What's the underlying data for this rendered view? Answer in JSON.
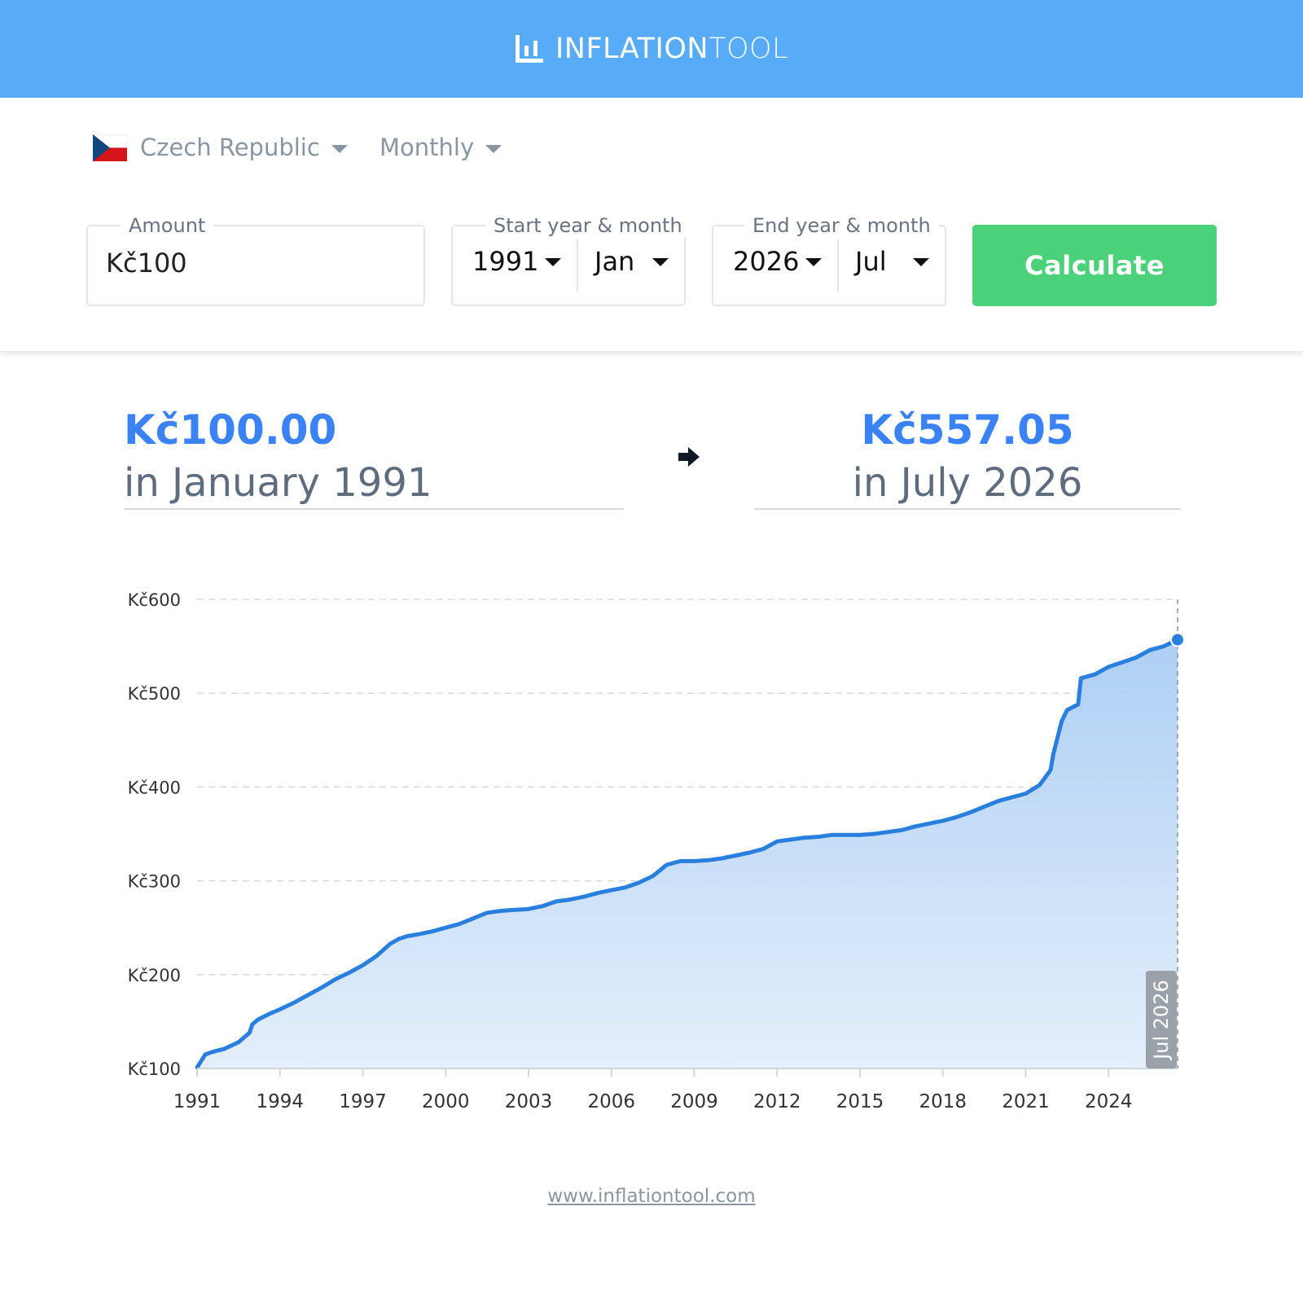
{
  "header": {
    "logo_bold": "INFLATION",
    "logo_light": "TOOL",
    "logo_icon": "bar-chart-icon"
  },
  "controls": {
    "country": "Czech Republic",
    "frequency": "Monthly",
    "amount_label": "Amount",
    "amount_value": "Kč100",
    "start_label": "Start year & month",
    "start_year": "1991",
    "start_month": "Jan",
    "end_label": "End year & month",
    "end_year": "2026",
    "end_month": "Jul",
    "calculate_label": "Calculate"
  },
  "result": {
    "start_amount": "Kč100.00",
    "start_when": "in January 1991",
    "end_amount": "Kč557.05",
    "end_when": "in July 2026"
  },
  "colors": {
    "header": "#58acf7",
    "accent": "#3b82f6",
    "line": "#2a7fdc",
    "button": "#4bd17a"
  },
  "chart_data": {
    "type": "area",
    "x_ticks": [
      "1991",
      "1994",
      "1997",
      "2000",
      "2003",
      "2006",
      "2009",
      "2012",
      "2015",
      "2018",
      "2021",
      "2024"
    ],
    "y_ticks": [
      "Kč100",
      "Kč200",
      "Kč300",
      "Kč400",
      "Kč500",
      "Kč600"
    ],
    "ylim": [
      100,
      600
    ],
    "xlim": [
      1991.0,
      2026.5
    ],
    "grid": true,
    "marker_label": "Jul 2026",
    "series": [
      {
        "x": [
          1991.0,
          1991.3,
          1991.6,
          1992.0,
          1992.5,
          1992.9,
          1993.0,
          1993.2,
          1993.6,
          1994.0,
          1994.5,
          1995.0,
          1995.5,
          1996.0,
          1996.5,
          1997.0,
          1997.5,
          1998.0,
          1998.3,
          1998.6,
          1999.0,
          1999.5,
          2000.0,
          2000.5,
          2001.0,
          2001.5,
          2002.0,
          2002.5,
          2003.0,
          2003.5,
          2004.0,
          2004.5,
          2005.0,
          2005.5,
          2006.0,
          2006.5,
          2007.0,
          2007.5,
          2008.0,
          2008.5,
          2009.0,
          2009.5,
          2010.0,
          2010.5,
          2011.0,
          2011.5,
          2012.0,
          2012.5,
          2013.0,
          2013.5,
          2014.0,
          2014.5,
          2015.0,
          2015.5,
          2016.0,
          2016.5,
          2017.0,
          2017.5,
          2018.0,
          2018.5,
          2019.0,
          2019.5,
          2020.0,
          2020.5,
          2021.0,
          2021.5,
          2021.9,
          2022.0,
          2022.3,
          2022.5,
          2022.9,
          2023.0,
          2023.5,
          2024.0,
          2024.5,
          2025.0,
          2025.5,
          2026.0,
          2026.5
        ],
        "y": [
          101,
          115,
          118,
          121,
          128,
          138,
          147,
          152,
          158,
          163,
          170,
          178,
          186,
          195,
          202,
          210,
          220,
          233,
          238,
          241,
          243,
          246,
          250,
          254,
          260,
          266,
          268,
          269,
          270,
          273,
          278,
          280,
          283,
          287,
          290,
          293,
          298,
          305,
          317,
          321,
          321,
          322,
          324,
          327,
          330,
          334,
          342,
          344,
          346,
          347,
          349,
          349,
          349,
          350,
          352,
          354,
          358,
          361,
          364,
          368,
          373,
          379,
          385,
          389,
          393,
          402,
          418,
          435,
          470,
          482,
          488,
          516,
          520,
          528,
          533,
          538,
          546,
          550,
          557
        ]
      }
    ]
  }
}
